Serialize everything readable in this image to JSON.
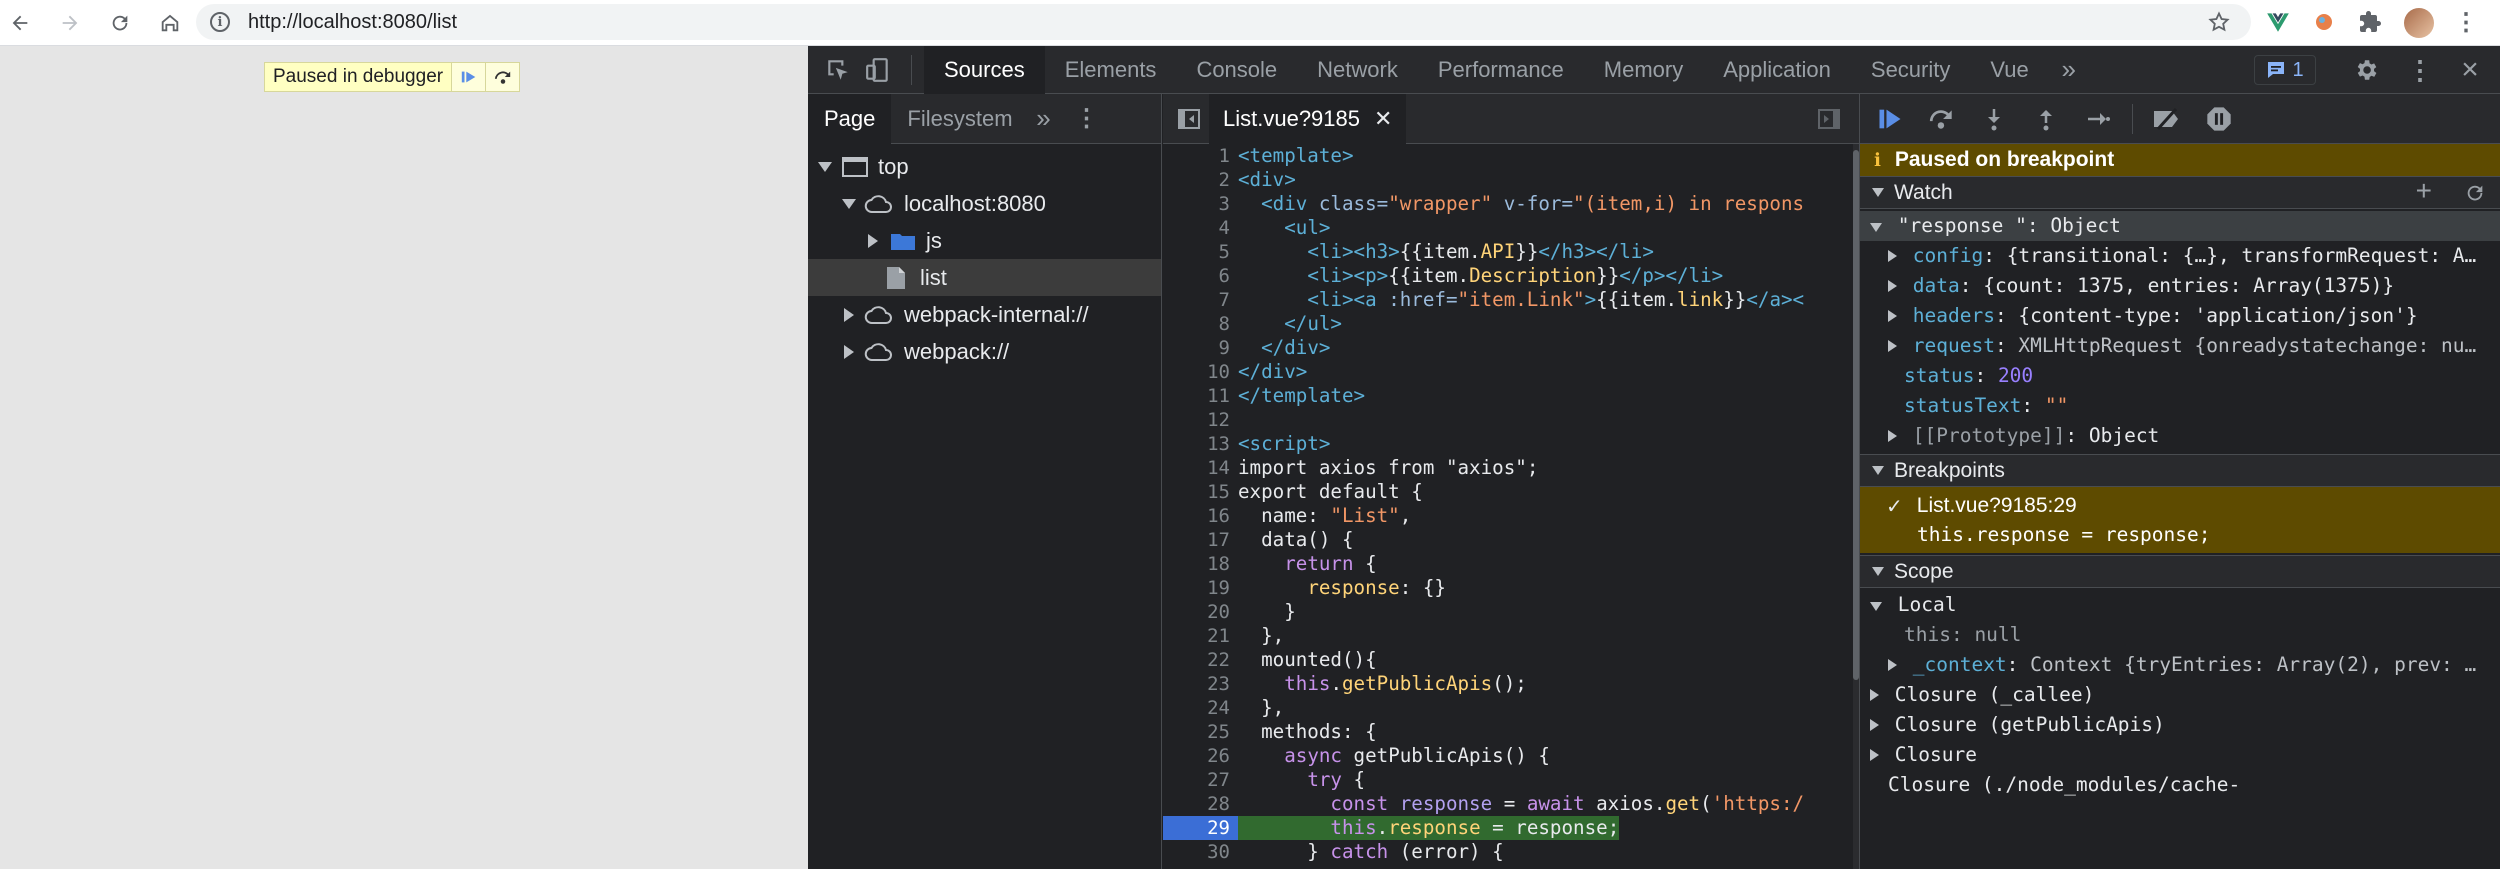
{
  "browser": {
    "url": "http://localhost:8080/list"
  },
  "page": {
    "paused_text": "Paused in debugger"
  },
  "devtools": {
    "tabs": [
      "Sources",
      "Elements",
      "Console",
      "Network",
      "Performance",
      "Memory",
      "Application",
      "Security",
      "Vue"
    ],
    "issues_count": "1",
    "navigator": {
      "tabs": [
        "Page",
        "Filesystem"
      ],
      "tree": [
        {
          "label": "top",
          "kind": "frame"
        },
        {
          "label": "localhost:8080",
          "kind": "cloud"
        },
        {
          "label": "js",
          "kind": "folder"
        },
        {
          "label": "list",
          "kind": "file"
        },
        {
          "label": "webpack-internal://",
          "kind": "cloud"
        },
        {
          "label": "webpack://",
          "kind": "cloud"
        }
      ]
    },
    "editor": {
      "file_tab": "List.vue?9185",
      "current_line": 29
    },
    "sidebar": {
      "paused_banner": "Paused on breakpoint",
      "watch": {
        "title": "Watch",
        "expression": "\"response \": Object",
        "rows": [
          {
            "key": "config",
            "value": "{transitional: {…}, transformRequest: A…"
          },
          {
            "key": "data",
            "value": "{count: 1375, entries: Array(1375)}"
          },
          {
            "key": "headers",
            "value": "{content-type: 'application/json'}"
          },
          {
            "key": "request",
            "value": "XMLHttpRequest {onreadystatechange: nu…"
          },
          {
            "key": "status",
            "value": "200"
          },
          {
            "key": "statusText",
            "value": "\"\""
          },
          {
            "key": "[[Prototype]]",
            "value": "Object"
          }
        ]
      },
      "breakpoints": {
        "title": "Breakpoints",
        "location": "List.vue?9185:29",
        "code": "this.response = response;"
      },
      "scope": {
        "title": "Scope",
        "local": "Local",
        "this_row": "this: null",
        "context_row": "Context {tryEntries: Array(2), prev: …",
        "context_key": "_context",
        "closures": [
          "Closure (_callee)",
          "Closure (getPublicApis)",
          "Closure",
          "Closure (./node_modules/cache-"
        ]
      }
    }
  }
}
